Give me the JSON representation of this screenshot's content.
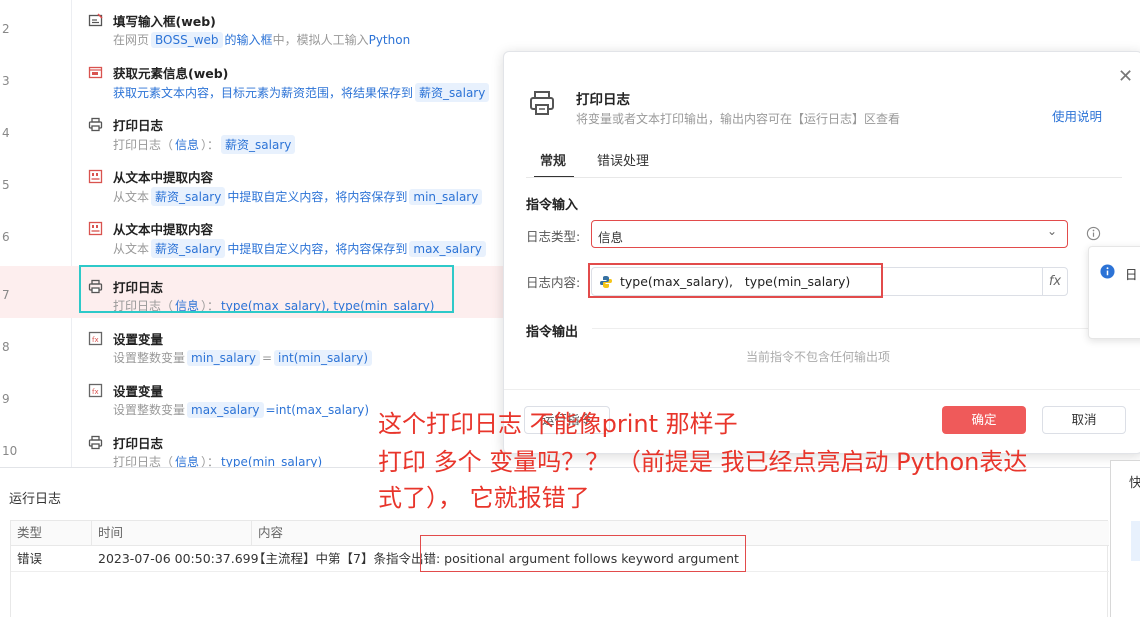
{
  "flow": {
    "steps": [
      {
        "line": "2",
        "title": "填写输入框(web)",
        "icon": "input-box-icon",
        "desc": [
          {
            "t": "在网页"
          },
          {
            "chip": "BOSS_web"
          },
          {
            "t": "的输入框中，模拟人工输入Python",
            "c": "mixed"
          }
        ]
      },
      {
        "line": "3",
        "title": "获取元素信息(web)",
        "icon": "web-element-icon",
        "desc": [
          {
            "t": "获取元素文本内容，目标元素为薪资范围，将结果保存到",
            "c": "blue"
          },
          {
            "chip": "薪资_salary"
          }
        ]
      },
      {
        "line": "4",
        "title": "打印日志",
        "icon": "printer-icon",
        "desc": [
          {
            "t": "打印日志（"
          },
          {
            "t": "信息",
            "c": "blue"
          },
          {
            "t": "）："
          },
          {
            "chip": "薪资_salary"
          }
        ]
      },
      {
        "line": "5",
        "title": "从文本中提取内容",
        "icon": "text-extract-icon",
        "desc": [
          {
            "t": "从文本"
          },
          {
            "chip": "薪资_salary"
          },
          {
            "t": "中提取自定义内容，将内容保存到",
            "c": "blue"
          },
          {
            "chip": "min_salary"
          }
        ]
      },
      {
        "line": "6",
        "title": "从文本中提取内容",
        "icon": "text-extract-icon",
        "desc": [
          {
            "t": "从文本"
          },
          {
            "chip": "薪资_salary"
          },
          {
            "t": "中提取自定义内容，将内容保存到",
            "c": "blue"
          },
          {
            "chip": "max_salary"
          }
        ]
      },
      {
        "line": "7",
        "title": "打印日志",
        "icon": "printer-icon",
        "active": true,
        "desc": [
          {
            "t": "打印日志（"
          },
          {
            "t": "信息",
            "c": "blue"
          },
          {
            "t": "）："
          },
          {
            "t": "type(max_salary),   type(min_salary)",
            "c": "blue"
          }
        ]
      },
      {
        "line": "8",
        "title": "设置变量",
        "icon": "variable-icon",
        "desc": [
          {
            "t": "设置整数变量"
          },
          {
            "chip": "min_salary"
          },
          {
            "t": "="
          },
          {
            "chip": "int(min_salary)"
          }
        ]
      },
      {
        "line": "9",
        "title": "设置变量",
        "icon": "variable-icon",
        "desc": [
          {
            "t": "设置整数变量"
          },
          {
            "chip": "max_salary"
          },
          {
            "t": "=int(max_salary)",
            "c": "blue"
          }
        ]
      },
      {
        "line": "10",
        "title": "打印日志",
        "icon": "printer-icon",
        "desc": [
          {
            "t": "打印日志（"
          },
          {
            "t": "信息",
            "c": "blue"
          },
          {
            "t": "）："
          },
          {
            "t": "type(min_salary)",
            "c": "blue"
          }
        ]
      }
    ]
  },
  "dialog": {
    "title": "打印日志",
    "subtitle": "将变量或者文本打印输出，输出内容可在【运行日志】区查看",
    "help_link": "使用说明",
    "tabs": [
      "常规",
      "错误处理"
    ],
    "section_input": "指令输入",
    "log_type_label": "日志类型:",
    "log_type_value": "信息",
    "log_content_label": "日志内容:",
    "log_content_value": "type(max_salary),   type(min_salary)",
    "fx_label": "fx",
    "section_output": "指令输出",
    "no_output": "当前指令不包含任何输出项",
    "run_button": "运行指令",
    "ok_button": "确定",
    "cancel_button": "取消"
  },
  "popover": {
    "text": "日"
  },
  "log": {
    "title": "运行日志",
    "columns": [
      "类型",
      "时间",
      "内容"
    ],
    "rows": [
      {
        "type": "错误",
        "time": "2023-07-06 00:50:37.699",
        "content": "【主流程】中第【7】条指令出错:  positional argument follows keyword argument"
      }
    ]
  },
  "edge": {
    "text": "快"
  },
  "annotation": {
    "line1": "这个打印日志 不能像print 那样子",
    "line2": "打印 多个 变量吗？？ （前提是 我已经点亮启动 Python表达",
    "line3": "式了），  它就报错了"
  },
  "colors": {
    "accent_blue": "#2c73d6",
    "danger_red": "#e24b4b",
    "highlight_cyan": "#2ec9c9",
    "ok_button": "#ef5a5a"
  }
}
